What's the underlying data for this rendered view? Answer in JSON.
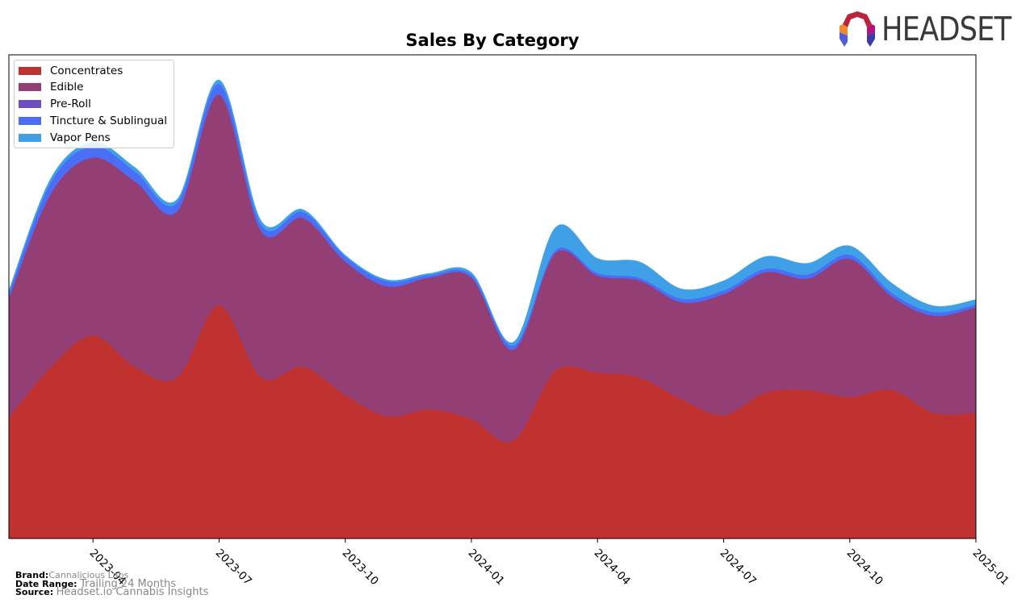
{
  "header": {
    "title": "Sales By Category",
    "logo_text": "HEADSET"
  },
  "legend": {
    "items": [
      {
        "label": "Concentrates",
        "color": "#c0322f"
      },
      {
        "label": "Edible",
        "color": "#933f76"
      },
      {
        "label": "Pre-Roll",
        "color": "#6e4fc2"
      },
      {
        "label": "Tincture & Sublingual",
        "color": "#4a6ef5"
      },
      {
        "label": "Vapor Pens",
        "color": "#3fa0e8"
      }
    ]
  },
  "footer": {
    "brand_label": "Brand:",
    "brand_value": "Cannalicious Labs",
    "date_label": "Date Range:",
    "date_value": "Trailing 24 Months",
    "source_label": "Source:",
    "source_value": "Headset.io Cannabis Insights"
  },
  "chart_data": {
    "type": "area",
    "stacked": true,
    "title": "Sales By Category",
    "xlabel": "",
    "ylabel": "",
    "ylim": [
      0,
      100
    ],
    "y_units": "relative (no y-axis labels shown)",
    "legend_position": "top-left",
    "grid": false,
    "x": [
      "2023-02",
      "2023-03",
      "2023-04",
      "2023-05",
      "2023-06",
      "2023-07",
      "2023-08",
      "2023-09",
      "2023-10",
      "2023-11",
      "2023-12",
      "2024-01",
      "2024-02",
      "2024-03",
      "2024-04",
      "2024-05",
      "2024-06",
      "2024-07",
      "2024-08",
      "2024-09",
      "2024-10",
      "2024-11",
      "2024-12",
      "2025-01"
    ],
    "xticks": [
      "2023-04",
      "2023-07",
      "2023-10",
      "2024-01",
      "2024-04",
      "2024-07",
      "2024-10",
      "2025-01"
    ],
    "series": [
      {
        "name": "Concentrates",
        "color": "#c0322f",
        "values": [
          25.0,
          35.5,
          42.0,
          35.5,
          33.3,
          48.2,
          33.3,
          35.5,
          29.7,
          25.3,
          26.7,
          24.7,
          20.2,
          34.7,
          34.3,
          33.3,
          28.8,
          25.5,
          30.2,
          30.7,
          29.3,
          30.7,
          26.0,
          26.0
        ]
      },
      {
        "name": "Edible",
        "color": "#933f76",
        "values": [
          24.7,
          35.8,
          36.7,
          38.3,
          34.3,
          43.5,
          30.2,
          30.7,
          27.5,
          26.8,
          27.2,
          29.2,
          18.8,
          24.3,
          20.0,
          20.0,
          20.0,
          25.0,
          24.8,
          23.0,
          28.5,
          19.3,
          20.0,
          21.8
        ]
      },
      {
        "name": "Pre-Roll",
        "color": "#6e4fc2",
        "values": [
          0.1,
          0.1,
          0.1,
          0.1,
          0.1,
          0.1,
          0.1,
          0.1,
          0.1,
          0.1,
          0.1,
          0.1,
          0.1,
          0.1,
          0.1,
          0.1,
          0.1,
          0.1,
          0.1,
          0.1,
          0.1,
          0.1,
          0.1,
          0.1
        ]
      },
      {
        "name": "Tincture & Sublingual",
        "color": "#4a6ef5",
        "values": [
          1.0,
          2.3,
          2.3,
          2.0,
          1.7,
          2.2,
          1.3,
          1.2,
          1.0,
          1.0,
          0.5,
          0.5,
          0.8,
          0.5,
          0.5,
          0.5,
          0.7,
          0.7,
          0.7,
          0.8,
          0.8,
          0.7,
          0.7,
          0.5
        ]
      },
      {
        "name": "Vapor Pens",
        "color": "#3fa0e8",
        "values": [
          0.5,
          0.8,
          0.8,
          0.8,
          0.7,
          0.8,
          0.8,
          0.5,
          0.3,
          0.3,
          0.3,
          0.5,
          0.7,
          4.7,
          3.0,
          3.3,
          2.0,
          2.0,
          2.5,
          2.3,
          1.8,
          2.0,
          1.3,
          1.0
        ]
      }
    ]
  }
}
